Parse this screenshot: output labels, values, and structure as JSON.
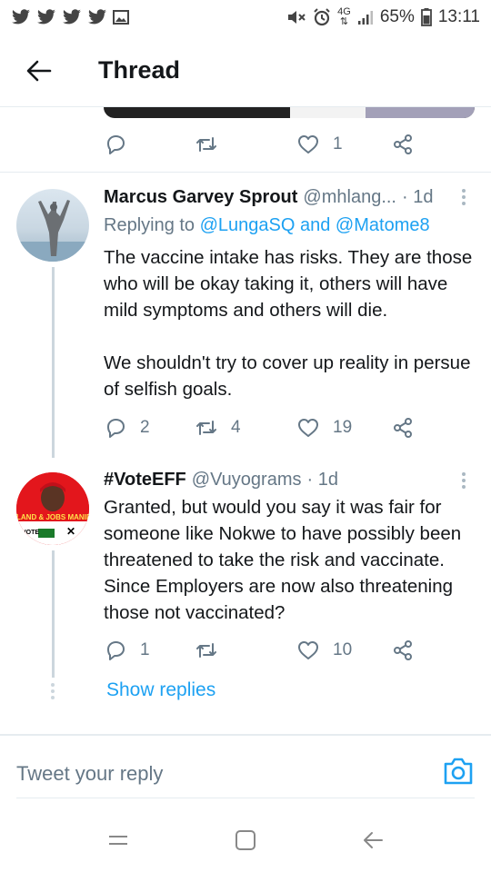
{
  "status_bar": {
    "network": "4G",
    "battery": "65%",
    "time": "13:11"
  },
  "header": {
    "title": "Thread"
  },
  "previous_tweet": {
    "replies": "",
    "retweets": "",
    "likes": "1"
  },
  "tweets": [
    {
      "name": "Marcus Garvey Sprout",
      "handle": "@mhlang...",
      "time": "· 1d",
      "replying_prefix": "Replying to",
      "replying_to": "@LungaSQ and @Matome8",
      "text": "The vaccine intake has risks. They are those who will be okay taking it, others will have mild symptoms and others will die.\n\nWe shouldn't try to cover up reality in persue of selfish goals.",
      "replies": "2",
      "retweets": "4",
      "likes": "19"
    },
    {
      "name": "#VoteEFF",
      "handle": "@Vuyograms",
      "time": "· 1d",
      "avatar_text_top": "LAND & JOBS MANIFE",
      "avatar_text_bottom": "VOTE",
      "text": "Granted, but would you say it was fair for someone like Nokwe to have possibly been threatened to take the risk and vaccinate. Since Employers are now also threatening those not vaccinated?",
      "replies": "1",
      "retweets": "",
      "likes": "10"
    }
  ],
  "show_replies": "Show replies",
  "reply_bar": {
    "placeholder": "Tweet your reply"
  },
  "colors": {
    "accent": "#1da1f2",
    "muted": "#657786",
    "text": "#14171a",
    "divider": "#e6ecf0"
  }
}
